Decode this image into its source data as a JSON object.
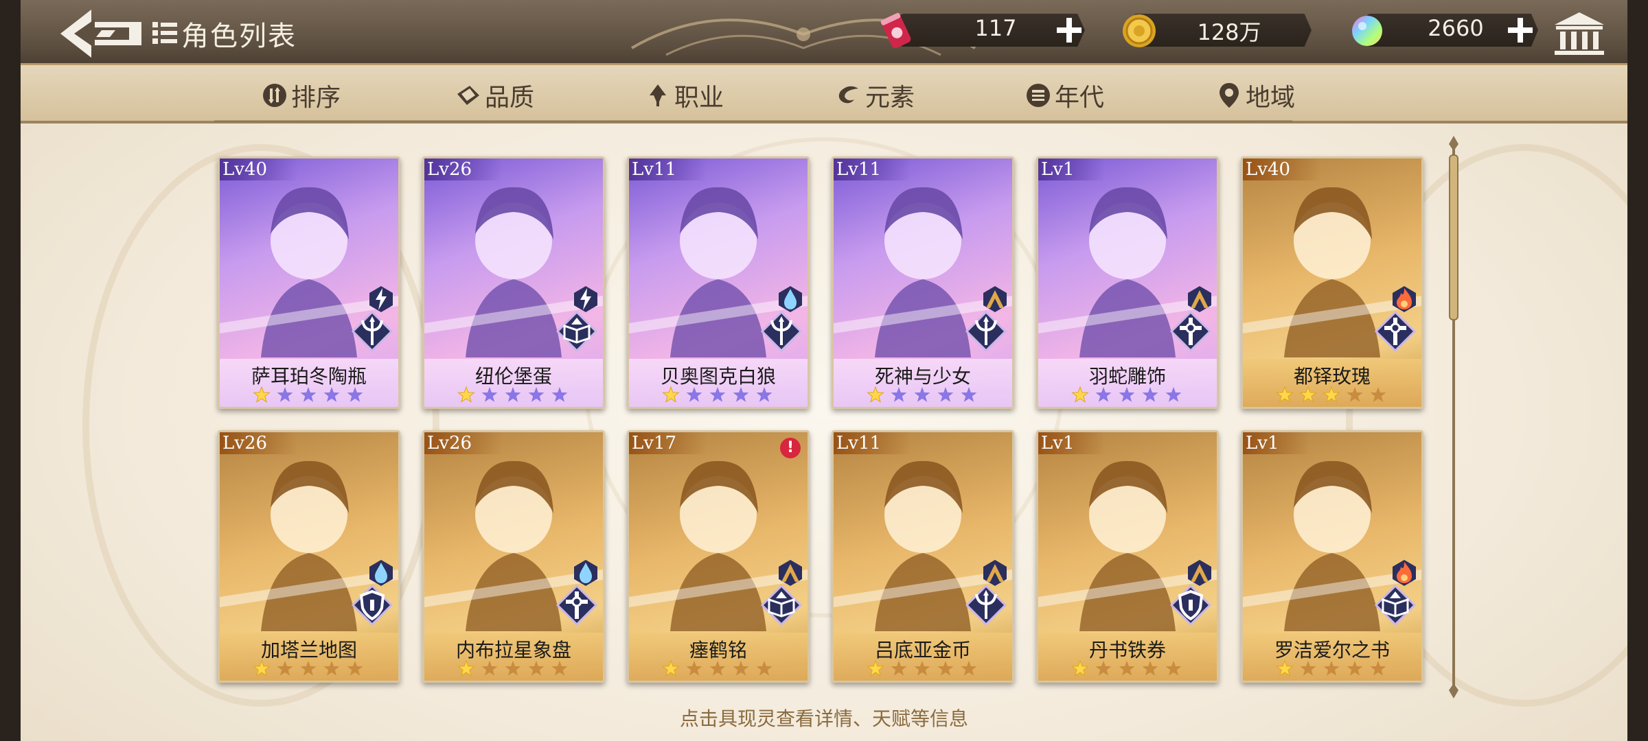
{
  "header": {
    "title": "角色列表",
    "resources": [
      {
        "icon": "energy-drink-icon",
        "value": "117"
      },
      {
        "icon": "gold-coin-icon",
        "value": "128万"
      },
      {
        "icon": "rainbow-gem-icon",
        "value": "2660"
      }
    ]
  },
  "tabs": [
    {
      "label": "排序",
      "icon": "sort-icon"
    },
    {
      "label": "品质",
      "icon": "quality-icon"
    },
    {
      "label": "职业",
      "icon": "profession-icon"
    },
    {
      "label": "元素",
      "icon": "element-icon"
    },
    {
      "label": "年代",
      "icon": "era-icon"
    },
    {
      "label": "地域",
      "icon": "region-icon"
    }
  ],
  "characters": [
    {
      "level": "Lv40",
      "name": "萨耳珀冬陶瓶",
      "rarity": "purple",
      "stars": 1,
      "element": "lightning-icon",
      "class": "trident-icon"
    },
    {
      "level": "Lv26",
      "name": "纽伦堡蛋",
      "rarity": "purple",
      "stars": 1,
      "element": "lightning-icon",
      "class": "book-icon"
    },
    {
      "level": "Lv11",
      "name": "贝奥图克白狼",
      "rarity": "purple",
      "stars": 1,
      "element": "water-drop-icon",
      "class": "trident-icon"
    },
    {
      "level": "Lv11",
      "name": "死神与少女",
      "rarity": "purple",
      "stars": 1,
      "element": "earth-icon",
      "class": "trident-icon"
    },
    {
      "level": "Lv1",
      "name": "羽蛇雕饰",
      "rarity": "purple",
      "stars": 1,
      "element": "earth-icon",
      "class": "cross-icon"
    },
    {
      "level": "Lv40",
      "name": "都铎玫瑰",
      "rarity": "gold",
      "stars": 3,
      "element": "fire-icon",
      "class": "cross-icon"
    },
    {
      "level": "Lv26",
      "name": "加塔兰地图",
      "rarity": "gold",
      "stars": 1,
      "element": "water-drop-icon",
      "class": "shield-icon"
    },
    {
      "level": "Lv26",
      "name": "内布拉星象盘",
      "rarity": "gold",
      "stars": 1,
      "element": "water-drop-icon",
      "class": "cross-icon"
    },
    {
      "level": "Lv17",
      "name": "瘗鹤铭",
      "rarity": "gold",
      "stars": 1,
      "element": "earth-icon",
      "class": "book-icon",
      "alert": "!"
    },
    {
      "level": "Lv11",
      "name": "吕底亚金币",
      "rarity": "gold",
      "stars": 1,
      "element": "earth-icon",
      "class": "trident-icon"
    },
    {
      "level": "Lv1",
      "name": "丹书铁券",
      "rarity": "gold",
      "stars": 1,
      "element": "earth-icon",
      "class": "shield-icon"
    },
    {
      "level": "Lv1",
      "name": "罗洁爱尔之书",
      "rarity": "gold",
      "stars": 1,
      "element": "fire-icon",
      "class": "book-icon"
    }
  ],
  "hint": "点击具现灵查看详情、天赋等信息",
  "colors": {
    "purple_card": "#b890ee",
    "gold_card": "#e3b066",
    "badge_bg": "#2b2f5e"
  }
}
